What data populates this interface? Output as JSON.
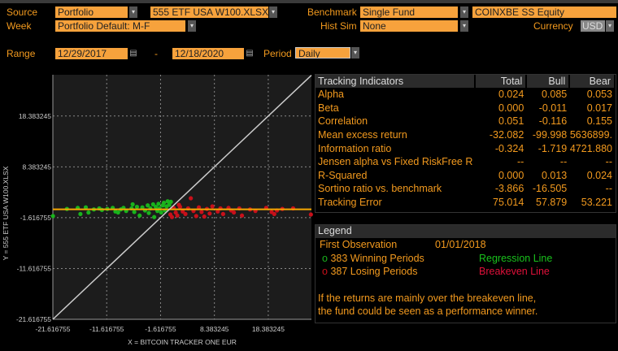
{
  "header": {
    "source_label": "Source",
    "source_value": "Portfolio",
    "portfolio_file": "555 ETF USA W100.XLSX",
    "benchmark_label": "Benchmark",
    "benchmark_value": "Single Fund",
    "benchmark_ticker": "COINXBE SS Equity",
    "week_label": "Week",
    "week_value": "Portfolio Default: M-F",
    "histsim_label": "Hist Sim",
    "histsim_value": "None",
    "currency_label": "Currency",
    "currency_value": "USD",
    "range_label": "Range",
    "range_start": "12/29/2017",
    "range_sep": "-",
    "range_end": "12/18/2020",
    "period_label": "Period",
    "period_value": "Daily",
    "accent": "#f7a23c"
  },
  "tracking": {
    "columns": [
      "Tracking Indicators",
      "Total",
      "Bull",
      "Bear"
    ],
    "rows": [
      [
        "Alpha",
        "0.024",
        "0.085",
        "0.053"
      ],
      [
        "Beta",
        "0.000",
        "-0.011",
        "0.017"
      ],
      [
        "Correlation",
        "0.051",
        "-0.116",
        "0.155"
      ],
      [
        "Mean excess return",
        "-32.082",
        "-99.998",
        "5636899."
      ],
      [
        "Information ratio",
        "-0.324",
        "-1.719",
        "4721.880"
      ],
      [
        "Jensen alpha vs Fixed RiskFree R",
        "--",
        "--",
        "--"
      ],
      [
        "R-Squared",
        "0.000",
        "0.013",
        "0.024"
      ],
      [
        "Sortino ratio vs. benchmark",
        "-3.866",
        "-16.505",
        "--"
      ],
      [
        "Tracking Error",
        "75.014",
        "57.879",
        "53.221"
      ]
    ]
  },
  "legend": {
    "title": "Legend",
    "first_obs_label": "First Observation",
    "first_obs_value": "01/01/2018",
    "winning": "o 383 Winning Periods",
    "losing": "o 387 Losing Periods",
    "regression": "Regression Line",
    "breakeven": "Breakeven Line",
    "note_line1": "If the returns are mainly over the breakeven line,",
    "note_line2": "the fund could be seen as a performance winner.",
    "win_color": "#19b31c",
    "lose_color": "#c8101a",
    "regression_color": "#19c21c",
    "breakeven_color": "#e0103a"
  },
  "chart_data": {
    "type": "scatter",
    "xlabel": "X = BITCOIN TRACKER ONE EUR",
    "ylabel": "Y = 555 ETF USA W100.XLSX",
    "xlim": [
      -21.616755,
      26.4
    ],
    "ylim": [
      -21.616755,
      26.5
    ],
    "xticks": [
      "-21.616755",
      "-11.616755",
      "-1.616755",
      "8.383245",
      "18.383245"
    ],
    "yticks": [
      "18.383245",
      "8.383245",
      "-1.616755",
      "-11.616755",
      "-21.616755"
    ],
    "grid": true,
    "breakeven_line": {
      "slope": 1,
      "intercept": 0,
      "color": "#cccccc"
    },
    "regression_line": {
      "slope": 0.0,
      "intercept": 0.02,
      "color": "#f7a800"
    },
    "winning_points": [
      [
        -21.6,
        -1.3
      ],
      [
        -19,
        0.1
      ],
      [
        -17,
        0.3
      ],
      [
        -16.5,
        -0.9
      ],
      [
        -15.5,
        0.4
      ],
      [
        -15,
        -0.6
      ],
      [
        -14,
        0
      ],
      [
        -13,
        0.2
      ],
      [
        -12.5,
        -0.1
      ],
      [
        -11.5,
        0.1
      ],
      [
        -10.5,
        0.3
      ],
      [
        -10,
        -0.4
      ],
      [
        -9,
        0
      ],
      [
        -8.5,
        0.3
      ],
      [
        -8,
        -0.3
      ],
      [
        -7,
        0.2
      ],
      [
        -6.5,
        -0.5
      ],
      [
        -6,
        0.5
      ],
      [
        -5.5,
        -1.2
      ],
      [
        -5,
        0.4
      ],
      [
        -4.5,
        -0.2
      ],
      [
        -4,
        0.8
      ],
      [
        -3.8,
        -0.7
      ],
      [
        -3.5,
        0.2
      ],
      [
        -3,
        1.0
      ],
      [
        -2.8,
        -1.5
      ],
      [
        -2.5,
        0.5
      ],
      [
        -2.2,
        -0.3
      ],
      [
        -2,
        1.1
      ],
      [
        -1.8,
        0.2
      ],
      [
        -1.5,
        -0.6
      ],
      [
        -1.2,
        0.8
      ],
      [
        -1,
        1.3
      ],
      [
        -0.8,
        -0.2
      ],
      [
        -0.5,
        0.6
      ],
      [
        -0.3,
        1.6
      ],
      [
        0,
        0.9
      ],
      [
        0.3,
        1.5
      ],
      [
        -6.8,
        1.0
      ],
      [
        -9.5,
        -0.6
      ]
    ],
    "losing_points": [
      [
        0.2,
        -1.0
      ],
      [
        0.5,
        -1.5
      ],
      [
        0.8,
        0.3
      ],
      [
        1.2,
        -0.6
      ],
      [
        1.5,
        -1.2
      ],
      [
        2,
        0.5
      ],
      [
        2.5,
        -0.4
      ],
      [
        3,
        -0.9
      ],
      [
        3.5,
        0.2
      ],
      [
        4,
        2.2
      ],
      [
        4.5,
        -0.3
      ],
      [
        5,
        -1.3
      ],
      [
        5.5,
        0.4
      ],
      [
        6,
        -0.5
      ],
      [
        7,
        0.1
      ],
      [
        7.5,
        -0.8
      ],
      [
        8,
        0.6
      ],
      [
        9,
        -0.4
      ],
      [
        9.5,
        0.2
      ],
      [
        10,
        -0.9
      ],
      [
        11,
        0.3
      ],
      [
        11.5,
        -0.2
      ],
      [
        12,
        -0.6
      ],
      [
        13,
        0.2
      ],
      [
        13.5,
        -1.2
      ],
      [
        15,
        0
      ],
      [
        16,
        -0.3
      ],
      [
        18,
        0.3
      ],
      [
        19,
        -0.5
      ],
      [
        19.5,
        -0.9
      ],
      [
        20,
        -0.2
      ],
      [
        21,
        0.1
      ],
      [
        23,
        0.2
      ],
      [
        26.3,
        -1.0
      ],
      [
        6.5,
        -1.4
      ],
      [
        1.8,
        0.9
      ]
    ]
  }
}
